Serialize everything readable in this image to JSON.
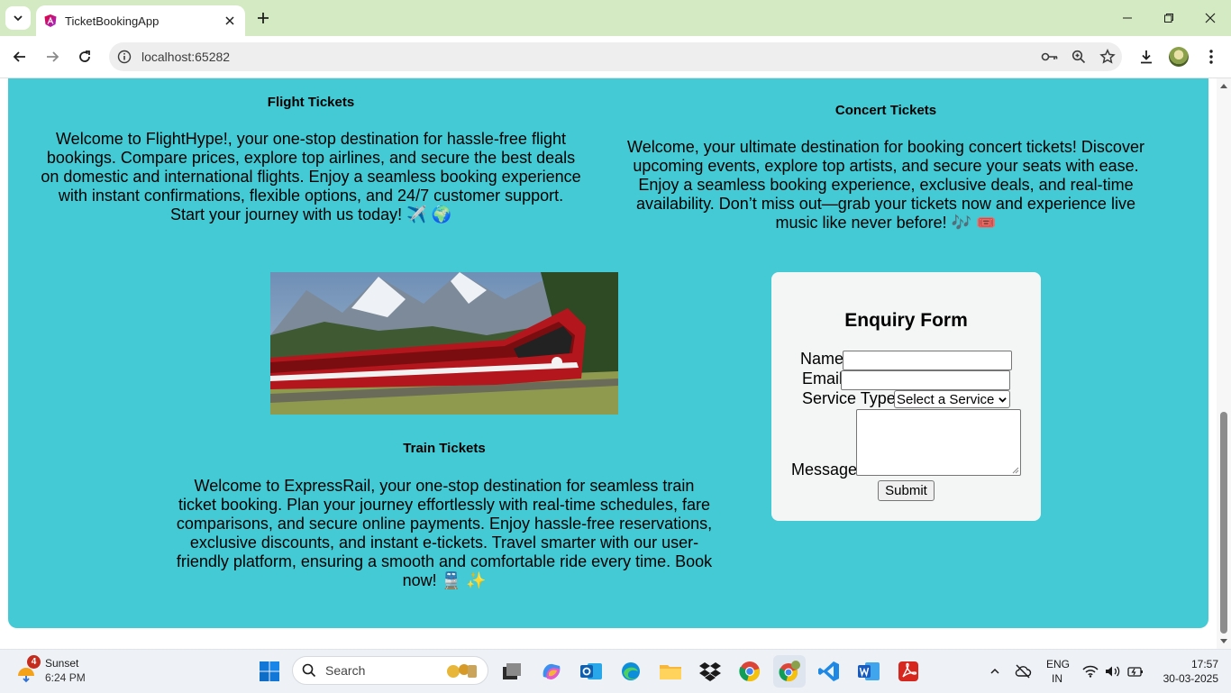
{
  "browser": {
    "tab_title": "TicketBookingApp",
    "url": "localhost:65282"
  },
  "flight": {
    "title": "Flight Tickets",
    "text": "Welcome to FlightHype!, your one-stop destination for hassle-free flight bookings. Compare prices, explore top airlines, and secure the best deals on domestic and international flights. Enjoy a seamless booking experience with instant confirmations, flexible options, and 24/7 customer support. Start your journey with us today! ✈️ 🌍"
  },
  "concert": {
    "title": "Concert Tickets",
    "text": "Welcome, your ultimate destination for booking concert tickets! Discover upcoming events, explore top artists, and secure your seats with ease. Enjoy a seamless booking experience, exclusive deals, and real-time availability. Don’t miss out—grab your tickets now and experience live music like never before! 🎶 🎟️"
  },
  "train": {
    "title": "Train Tickets",
    "text": "Welcome to ExpressRail, your one-stop destination for seamless train ticket booking. Plan your journey effortlessly with real-time schedules, fare comparisons, and secure online payments. Enjoy hassle-free reservations, exclusive discounts, and instant e-tickets. Travel smarter with our user-friendly platform, ensuring a smooth and comfortable ride every time. Book now! 🚆 ✨"
  },
  "enquiry_form": {
    "title": "Enquiry Form",
    "name_label": "Name",
    "email_label": "Email",
    "service_label": "Service Type",
    "service_selected": "Select a Service",
    "message_label": "Message",
    "submit_label": "Submit"
  },
  "taskbar": {
    "weather_badge": "4",
    "weather_title": "Sunset",
    "weather_time": "6:24 PM",
    "search_placeholder": "Search",
    "lang_line1": "ENG",
    "lang_line2": "IN",
    "clock_time": "17:57",
    "clock_date": "30-03-2025"
  },
  "colors": {
    "page_background": "#43cad4",
    "tab_strip": "#d3eac2",
    "card": "#f4f6f6"
  }
}
